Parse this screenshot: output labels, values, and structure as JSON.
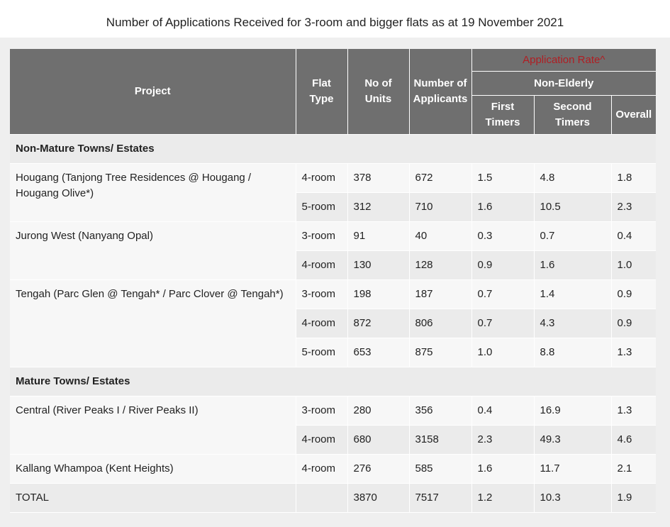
{
  "title": "Number of Applications Received for 3-room and bigger flats as at 19 November 2021",
  "colors": {
    "header_bg": "#6f6f6f",
    "header_text": "#ffffff",
    "rate_label": "#b01e23",
    "row_light": "#f7f7f7",
    "row_dark": "#ebebeb"
  },
  "headers": {
    "project": "Project",
    "flat_type": "Flat Type",
    "units": "No of Units",
    "applicants": "Number of Applicants",
    "application_rate": "Application Rate^",
    "non_elderly": "Non-Elderly",
    "first_timers": "First Timers",
    "second_timers": "Second Timers",
    "overall": "Overall"
  },
  "sections": [
    {
      "label": "Non-Mature Towns/ Estates",
      "projects": [
        {
          "name": "Hougang (Tanjong Tree Residences @ Hougang / Hougang Olive*)",
          "rows": [
            {
              "flat_type": "4-room",
              "units": "378",
              "applicants": "672",
              "first": "1.5",
              "second": "4.8",
              "overall": "1.8"
            },
            {
              "flat_type": "5-room",
              "units": "312",
              "applicants": "710",
              "first": "1.6",
              "second": "10.5",
              "overall": "2.3"
            }
          ]
        },
        {
          "name": "Jurong West (Nanyang Opal)",
          "rows": [
            {
              "flat_type": "3-room",
              "units": "91",
              "applicants": "40",
              "first": "0.3",
              "second": "0.7",
              "overall": "0.4"
            },
            {
              "flat_type": "4-room",
              "units": "130",
              "applicants": "128",
              "first": "0.9",
              "second": "1.6",
              "overall": "1.0"
            }
          ]
        },
        {
          "name": "Tengah (Parc Glen @ Tengah* / Parc Clover @ Tengah*)",
          "rows": [
            {
              "flat_type": "3-room",
              "units": "198",
              "applicants": "187",
              "first": "0.7",
              "second": "1.4",
              "overall": "0.9"
            },
            {
              "flat_type": "4-room",
              "units": "872",
              "applicants": "806",
              "first": "0.7",
              "second": "4.3",
              "overall": "0.9"
            },
            {
              "flat_type": "5-room",
              "units": "653",
              "applicants": "875",
              "first": "1.0",
              "second": "8.8",
              "overall": "1.3"
            }
          ]
        }
      ]
    },
    {
      "label": "Mature Towns/ Estates",
      "projects": [
        {
          "name": "Central (River Peaks I / River Peaks II)",
          "rows": [
            {
              "flat_type": "3-room",
              "units": "280",
              "applicants": "356",
              "first": "0.4",
              "second": "16.9",
              "overall": "1.3"
            },
            {
              "flat_type": "4-room",
              "units": "680",
              "applicants": "3158",
              "first": "2.3",
              "second": "49.3",
              "overall": "4.6"
            }
          ]
        },
        {
          "name": "Kallang Whampoa (Kent Heights)",
          "rows": [
            {
              "flat_type": "4-room",
              "units": "276",
              "applicants": "585",
              "first": "1.6",
              "second": "11.7",
              "overall": "2.1"
            }
          ]
        }
      ]
    }
  ],
  "total": {
    "label": "TOTAL",
    "flat_type": "",
    "units": "3870",
    "applicants": "7517",
    "first": "1.2",
    "second": "10.3",
    "overall": "1.9"
  }
}
